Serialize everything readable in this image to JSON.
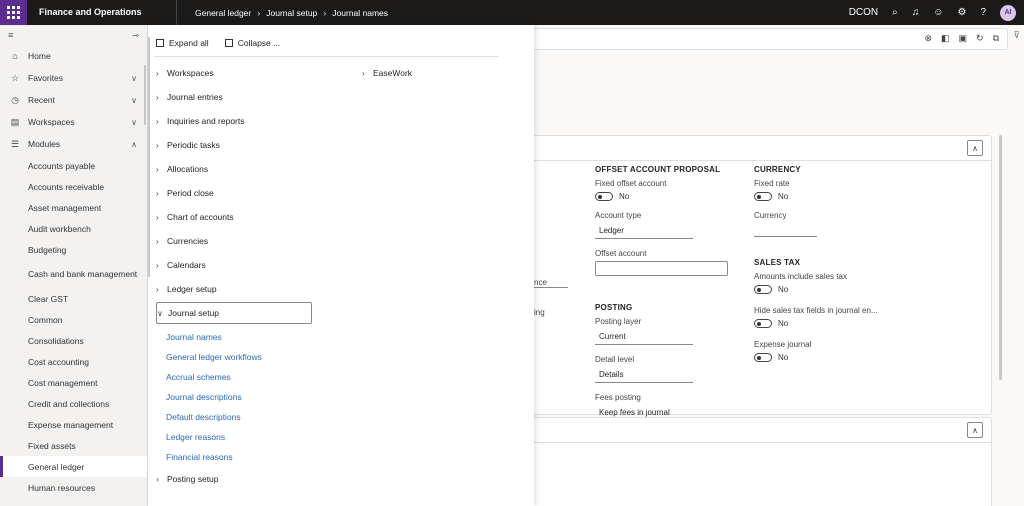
{
  "topbar": {
    "app_title": "Finance and Operations",
    "breadcrumbs": [
      "General ledger",
      "Journal setup",
      "Journal names"
    ],
    "company": "DCON",
    "avatar_initials": "AI"
  },
  "leftnav": {
    "items": [
      {
        "label": "Home",
        "icon": "home-icon"
      },
      {
        "label": "Favorites",
        "icon": "star-icon"
      },
      {
        "label": "Recent",
        "icon": "clock-icon"
      },
      {
        "label": "Workspaces",
        "icon": "workspace-icon"
      },
      {
        "label": "Modules",
        "icon": "list-icon"
      }
    ],
    "modules": [
      "Accounts payable",
      "Accounts receivable",
      "Asset management",
      "Audit workbench",
      "Budgeting",
      "Cash and bank management",
      "Clear GST",
      "Common",
      "Consolidations",
      "Cost accounting",
      "Cost management",
      "Credit and collections",
      "Expense management",
      "Fixed assets",
      "General ledger",
      "Human resources"
    ],
    "active_module": "General ledger"
  },
  "flyout": {
    "expand_all": "Expand all",
    "collapse_all": "Collapse ...",
    "groups": [
      "Workspaces",
      "Journal entries",
      "Inquiries and reports",
      "Periodic tasks",
      "Allocations",
      "Period close",
      "Chart of accounts",
      "Currencies",
      "Calendars",
      "Ledger setup"
    ],
    "expanded_group": "Journal setup",
    "links": [
      "Journal names",
      "General ledger workflows",
      "Accrual schemes",
      "Journal descriptions",
      "Default descriptions",
      "Ledger reasons",
      "Financial reasons"
    ],
    "after_group": "Posting setup",
    "col2_group": "EaseWork"
  },
  "form": {
    "partial_1": "nce",
    "partial_2": "ing",
    "offset": {
      "title": "OFFSET ACCOUNT PROPOSAL",
      "fixed_label": "Fixed offset account",
      "fixed_value": "No",
      "type_label": "Account type",
      "type_value": "Ledger",
      "account_label": "Offset account"
    },
    "posting": {
      "title": "POSTING",
      "layer_label": "Posting layer",
      "layer_value": "Current",
      "detail_label": "Detail level",
      "detail_value": "Details",
      "fees_label": "Fees posting",
      "fees_value": "Keep fees in journal"
    },
    "currency": {
      "title": "CURRENCY",
      "rate_label": "Fixed rate",
      "rate_value": "No",
      "currency_label": "Currency"
    },
    "salestax": {
      "title": "SALES TAX",
      "incl_label": "Amounts include sales tax",
      "incl_value": "No",
      "hide_label": "Hide sales tax fields in journal en...",
      "hide_value": "No",
      "expense_label": "Expense journal",
      "expense_value": "No"
    }
  }
}
